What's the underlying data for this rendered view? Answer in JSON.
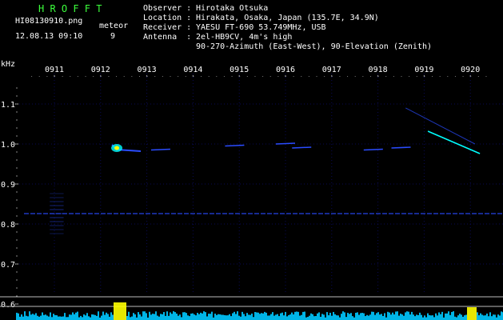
{
  "header": {
    "logo": "H R O F F T",
    "filename": "HI08130910.png",
    "datetime": "12.08.13 09:10",
    "meteor_label": "meteor",
    "meteor_count": "9",
    "observer_label": "Observer :",
    "observer_value": "Hirotaka Otsuka",
    "location_label": "Location :",
    "location_value": "Hirakata, Osaka, Japan (135.7E, 34.9N)",
    "receiver_label": "Receiver :",
    "receiver_value": "YAESU FT-690 53.749MHz, USB",
    "antenna_label": "Antenna  :",
    "antenna_value": "2el-HB9CV, 4m's high",
    "antenna_value2": "90-270-Azimuth (East-West), 90-Elevation (Zenith)"
  },
  "colors": {
    "background": "#000000",
    "grid": "#0a0a55",
    "text": "#ffffff",
    "logo": "#3cff3c",
    "signal": "#2a4cff",
    "bright": "#00ffff",
    "hot": "#ffff00",
    "power_fill": "#00c8ff"
  },
  "chart_data": {
    "type": "heatmap",
    "title": "",
    "xlabel": "",
    "ylabel": "kHz",
    "x_ticks": [
      "0911",
      "0912",
      "0913",
      "0914",
      "0915",
      "0916",
      "0917",
      "0918",
      "0919",
      "0920"
    ],
    "y_ticks": [
      "1.1",
      "1.0",
      "0.9",
      "0.8",
      "0.7",
      "0.6"
    ],
    "ylim": [
      0.58,
      1.16
    ],
    "carrier_khz": 0.826,
    "echoes": [
      {
        "minute": 12.35,
        "freq_khz": 0.99,
        "strength": "strong"
      },
      {
        "minute": 13.3,
        "freq_khz": 0.985,
        "strength": "weak"
      },
      {
        "minute": 14.9,
        "freq_khz": 0.995,
        "strength": "weak"
      },
      {
        "minute": 16.0,
        "freq_khz": 1.0,
        "strength": "weak"
      },
      {
        "minute": 16.35,
        "freq_khz": 0.99,
        "strength": "weak"
      },
      {
        "minute": 17.9,
        "freq_khz": 0.985,
        "strength": "weak"
      },
      {
        "minute": 18.5,
        "freq_khz": 0.99,
        "strength": "weak"
      },
      {
        "minute": 19.6,
        "freq_khz": 1.0,
        "strength": "moderate"
      }
    ]
  }
}
